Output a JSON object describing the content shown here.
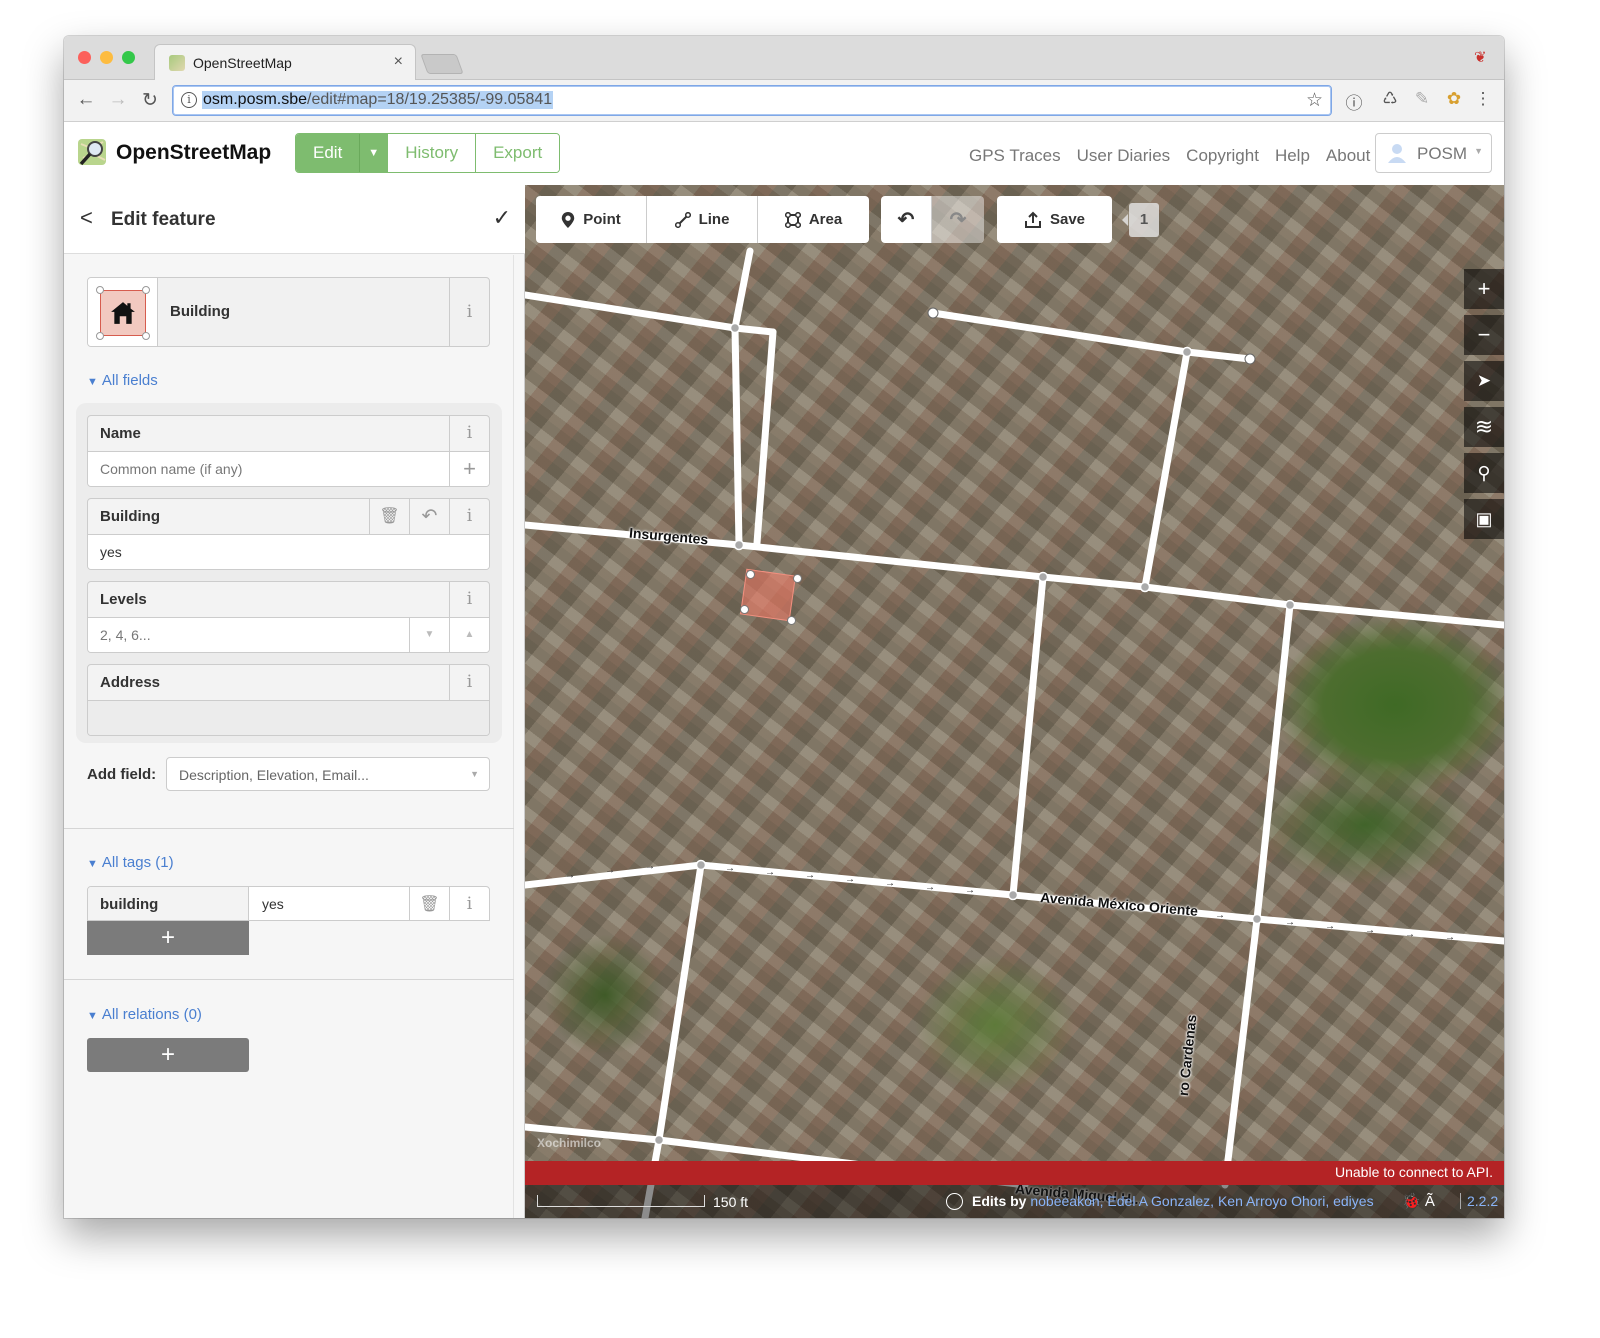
{
  "browser": {
    "tab_title": "OpenStreetMap",
    "tab_close": "×",
    "url_host": "osm.posm.sbe",
    "url_path": "/edit#map=18/19.25385/-99.05841",
    "nav_back": "←",
    "nav_forward": "→",
    "nav_reload": "↻",
    "star": "☆",
    "extensions": [
      "ⓘ",
      "♺",
      "✎",
      "✿",
      "⋮"
    ]
  },
  "header": {
    "logo_text": "OpenStreetMap",
    "edit_label": "Edit",
    "edit_caret": "▼",
    "history_label": "History",
    "export_label": "Export",
    "links": [
      "GPS Traces",
      "User Diaries",
      "Copyright",
      "Help",
      "About"
    ],
    "user_name": "POSM",
    "user_caret": "▼"
  },
  "sidebar": {
    "title": "Edit feature",
    "back": "<",
    "done": "✓",
    "preset_name": "Building",
    "info": "i",
    "all_fields": "All fields",
    "tri": "▼",
    "fields": {
      "name": {
        "label": "Name",
        "placeholder": "Common name (if any)",
        "add": "+"
      },
      "building": {
        "label": "Building",
        "value": "yes",
        "delete": "🗑",
        "revert": "↶"
      },
      "levels": {
        "label": "Levels",
        "placeholder": "2, 4, 6...",
        "down": "▼",
        "up": "▲"
      },
      "address": {
        "label": "Address"
      }
    },
    "add_field_label": "Add field:",
    "add_field_placeholder": "Description, Elevation, Email...",
    "add_field_caret": "▼",
    "all_tags": "All tags (1)",
    "tags": [
      {
        "key": "building",
        "value": "yes"
      }
    ],
    "add_tag": "+",
    "all_relations": "All relations (0)",
    "add_relation": "+"
  },
  "map": {
    "tools": {
      "point": "Point",
      "line": "Line",
      "area": "Area",
      "save": "Save"
    },
    "edit_count": "1",
    "controls": [
      "+",
      "−",
      "➤",
      "≋",
      "⚲",
      "▣"
    ],
    "streets": {
      "insurgentes": "Insurgentes",
      "mexico_oriente": "Avenida México Oriente",
      "cardenas": "ro Cardenas",
      "miguel": "Avenida Miguel H..."
    },
    "area_label": "Xochimilco",
    "error_message": "Unable to connect to API.",
    "scale_label": "150 ft",
    "edits_by_label": "Edits by",
    "edits_by_users": "nobeeakon, Edel A Gonzalez, Ken Arroyo Ohori, ediyes",
    "footer_icons": "🐞 Ã",
    "version": "2.2.2"
  },
  "colors": {
    "osm_green": "#7ebc6f",
    "link_blue": "#4a7fd0",
    "error_red": "#b42325",
    "selected_area": "#eb7864"
  }
}
